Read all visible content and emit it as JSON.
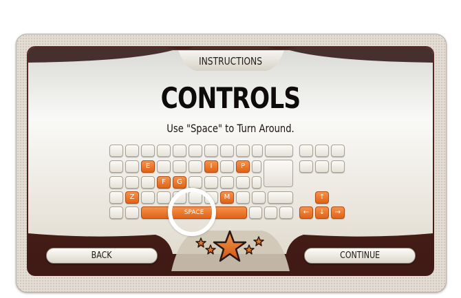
{
  "header": {
    "title": "INSTRUCTIONS"
  },
  "main": {
    "heading": "CONTROLS",
    "instruction": "Use \"Space\" to Turn Around."
  },
  "keyboard": {
    "highlighted_keys": [
      "E",
      "I",
      "P",
      "F",
      "G",
      "Z",
      "M",
      "SPACE",
      "↑",
      "←",
      "↓",
      "→"
    ],
    "labels": {
      "e": "E",
      "i": "I",
      "p": "P",
      "f": "F",
      "g": "G",
      "z": "Z",
      "m": "M",
      "space": "SPACE",
      "up": "↑",
      "left": "←",
      "down": "↓",
      "right": "→"
    }
  },
  "footer": {
    "back_label": "BACK",
    "continue_label": "CONTINUE"
  },
  "colors": {
    "accent": "#e8701e",
    "frame": "#4a1f19",
    "panel": "#f2f1ec"
  },
  "icons": [
    "star-icon",
    "highlight-ring"
  ]
}
